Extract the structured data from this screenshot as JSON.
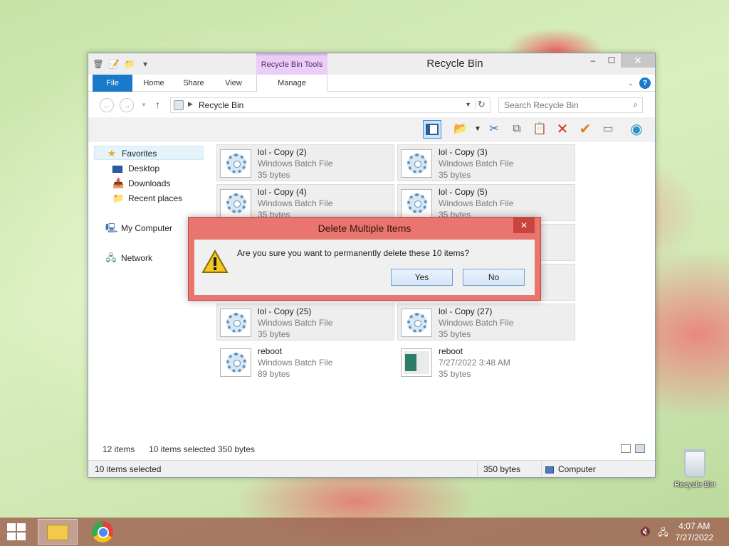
{
  "window": {
    "title": "Recycle Bin",
    "context_tab_title": "Recycle Bin Tools",
    "controls": {
      "minimize": "–",
      "maximize": "☐",
      "close": "✕"
    }
  },
  "ribbon": {
    "tabs": [
      "File",
      "Home",
      "Share",
      "View",
      "Manage"
    ],
    "help": "?"
  },
  "address": {
    "breadcrumb": "Recycle Bin",
    "search_placeholder": "Search Recycle Bin"
  },
  "nav": {
    "favorites": "Favorites",
    "desktop": "Desktop",
    "downloads": "Downloads",
    "recent": "Recent places",
    "computer": "My Computer",
    "network": "Network"
  },
  "files": [
    {
      "name": "lol - Copy (2)",
      "type": "Windows Batch File",
      "size": "35 bytes",
      "selected": true,
      "thumb": "gear"
    },
    {
      "name": "lol - Copy (3)",
      "type": "Windows Batch File",
      "size": "35 bytes",
      "selected": true,
      "thumb": "gear"
    },
    {
      "name": "lol - Copy (4)",
      "type": "Windows Batch File",
      "size": "35 bytes",
      "selected": true,
      "thumb": "gear"
    },
    {
      "name": "lol - Copy (5)",
      "type": "Windows Batch File",
      "size": "35 bytes",
      "selected": true,
      "thumb": "gear"
    },
    {
      "name": "lol - Copy (25)",
      "type": "Windows Batch File",
      "size": "35 bytes",
      "selected": true,
      "thumb": "gear"
    },
    {
      "name": "lol - Copy (27)",
      "type": "Windows Batch File",
      "size": "35 bytes",
      "selected": true,
      "thumb": "gear"
    },
    {
      "name": "reboot",
      "type": "Windows Batch File",
      "size": "89 bytes",
      "selected": false,
      "thumb": "gear"
    },
    {
      "name": "reboot",
      "type": "7/27/2022 3:48 AM",
      "size": "35 bytes",
      "selected": false,
      "thumb": "screenshot"
    }
  ],
  "summary": {
    "count": "12 items",
    "selected": "10 items selected",
    "size": "350 bytes"
  },
  "statusbar": {
    "selected": "10 items selected",
    "size": "350 bytes",
    "location": "Computer"
  },
  "dialog": {
    "title": "Delete Multiple Items",
    "message": "Are you sure you want to permanently delete these 10 items?",
    "yes": "Yes",
    "no": "No",
    "close": "✕"
  },
  "desktop_icon": {
    "label": "Recycle Bin"
  },
  "taskbar": {
    "time": "4:07 AM",
    "date": "7/27/2022"
  },
  "colors": {
    "file_tab": "#1979ca",
    "context_tab": "#e9cff5",
    "dialog_frame": "#e8766f",
    "dialog_close": "#c8443d",
    "taskbar": "#9e6252"
  }
}
